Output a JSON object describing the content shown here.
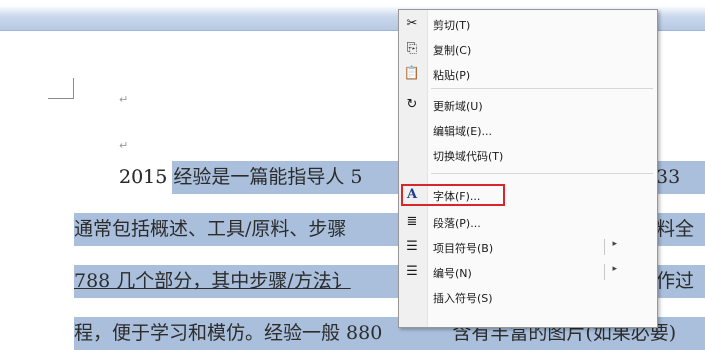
{
  "document": {
    "lines": [
      {
        "id": "line1",
        "text": "2015 经验是一篇能指导人 5",
        "right": "33"
      },
      {
        "id": "line2",
        "text": "通常包括概述、工具/原料、步骤",
        "right": "料全"
      },
      {
        "id": "line3",
        "text": "788 几个部分，其中步骤/方法讠",
        "right": "作过"
      },
      {
        "id": "line4",
        "text": "程，便于学习和模仿。经验一般 880",
        "right": "含有丰富的图片(如果必要)"
      }
    ],
    "paragraph_mark": "↵"
  },
  "context_menu": {
    "items": [
      {
        "label": "剪切(T)",
        "icon": "scissors-icon",
        "glyph": "✂"
      },
      {
        "label": "复制(C)",
        "icon": "copy-icon",
        "glyph": "⎘"
      },
      {
        "label": "粘贴(P)",
        "icon": "paste-icon",
        "glyph": "📋"
      },
      {
        "label": "更新域(U)",
        "icon": "update-field-icon",
        "glyph": "↻"
      },
      {
        "label": "编辑域(E)...",
        "icon": "",
        "glyph": ""
      },
      {
        "label": "切换域代码(T)",
        "icon": "",
        "glyph": ""
      },
      {
        "label": "字体(F)...",
        "icon": "font-icon",
        "glyph": "A"
      },
      {
        "label": "段落(P)...",
        "icon": "paragraph-icon",
        "glyph": "≣"
      },
      {
        "label": "项目符号(B)",
        "icon": "bullets-icon",
        "glyph": "☰"
      },
      {
        "label": "编号(N)",
        "icon": "numbering-icon",
        "glyph": "☰"
      },
      {
        "label": "插入符号(S)",
        "icon": "",
        "glyph": ""
      }
    ],
    "submenu_arrow": "▸",
    "highlight_color": "#d9262b"
  }
}
